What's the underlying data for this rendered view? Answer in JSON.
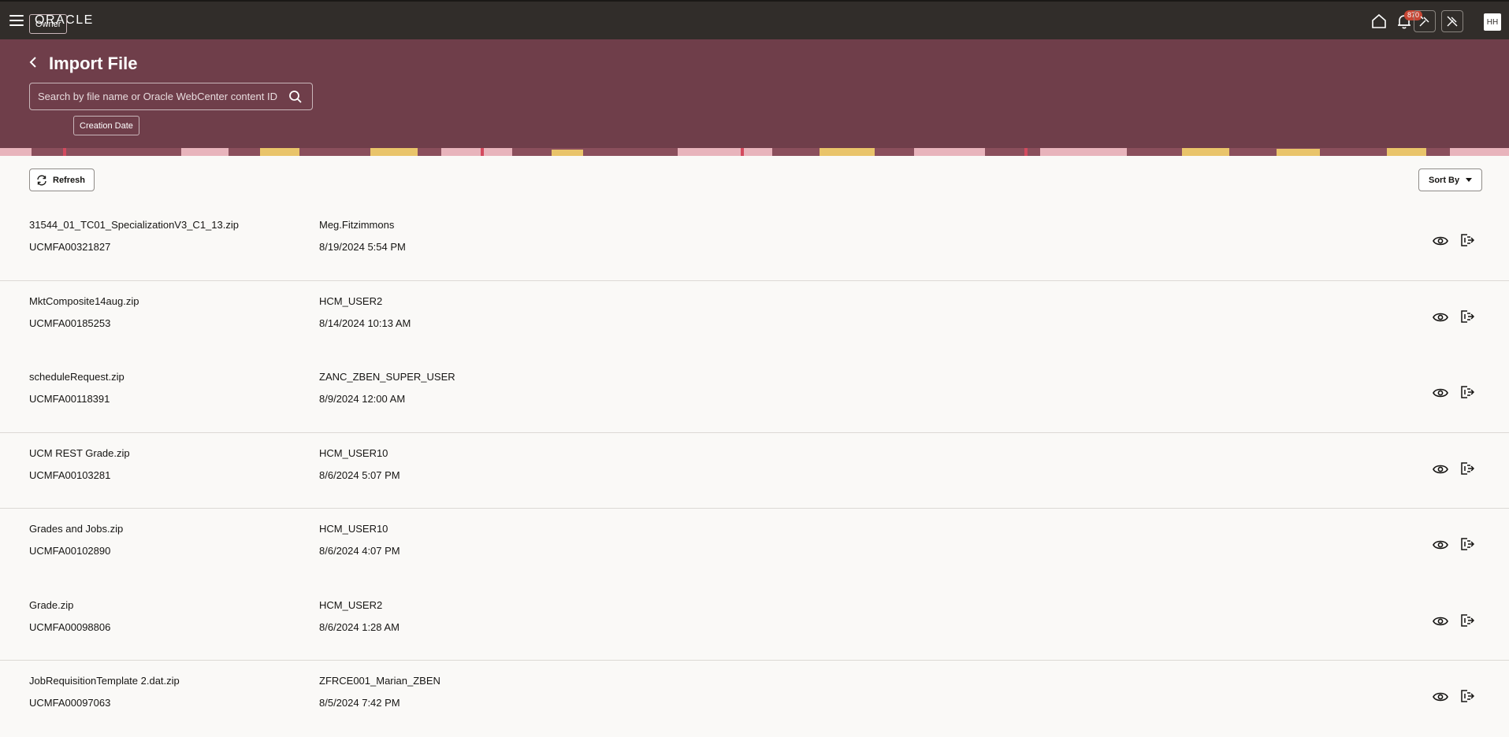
{
  "app": {
    "logo": "ORACLE",
    "notification_count": "870",
    "avatar_initials": "HH"
  },
  "page": {
    "title": "Import File",
    "search_placeholder": "Search by file name or Oracle WebCenter content ID",
    "filters": [
      "Owner",
      "Creation Date"
    ]
  },
  "toolbar": {
    "refresh_label": "Refresh",
    "sort_label": "Sort By"
  },
  "colors": {
    "topbar": "#312d2a",
    "header": "#6f3e4a",
    "badge": "#c74634"
  },
  "icons": [
    "menu-icon",
    "home-icon",
    "bell-icon",
    "tool-icon",
    "tool-off-icon",
    "back-arrow-icon",
    "search-icon",
    "refresh-icon",
    "eye-icon",
    "import-icon"
  ],
  "files": [
    {
      "name": "31544_01_TC01_SpecializationV3_C1_13.zip",
      "id": "UCMFA00321827",
      "owner": "Meg.Fitzimmons",
      "date": "8/19/2024 5:54 PM"
    },
    {
      "name": "MktComposite14aug.zip",
      "id": "UCMFA00185253",
      "owner": "HCM_USER2",
      "date": "8/14/2024 10:13 AM"
    },
    {
      "name": "scheduleRequest.zip",
      "id": "UCMFA00118391",
      "owner": "ZANC_ZBEN_SUPER_USER",
      "date": "8/9/2024 12:00 AM"
    },
    {
      "name": "UCM REST Grade.zip",
      "id": "UCMFA00103281",
      "owner": "HCM_USER10",
      "date": "8/6/2024 5:07 PM"
    },
    {
      "name": "Grades and Jobs.zip",
      "id": "UCMFA00102890",
      "owner": "HCM_USER10",
      "date": "8/6/2024 4:07 PM"
    },
    {
      "name": "Grade.zip",
      "id": "UCMFA00098806",
      "owner": "HCM_USER2",
      "date": "8/6/2024 1:28 AM"
    },
    {
      "name": "JobRequisitionTemplate 2.dat.zip",
      "id": "UCMFA00097063",
      "owner": "ZFRCE001_Marian_ZBEN",
      "date": "8/5/2024 7:42 PM"
    }
  ]
}
